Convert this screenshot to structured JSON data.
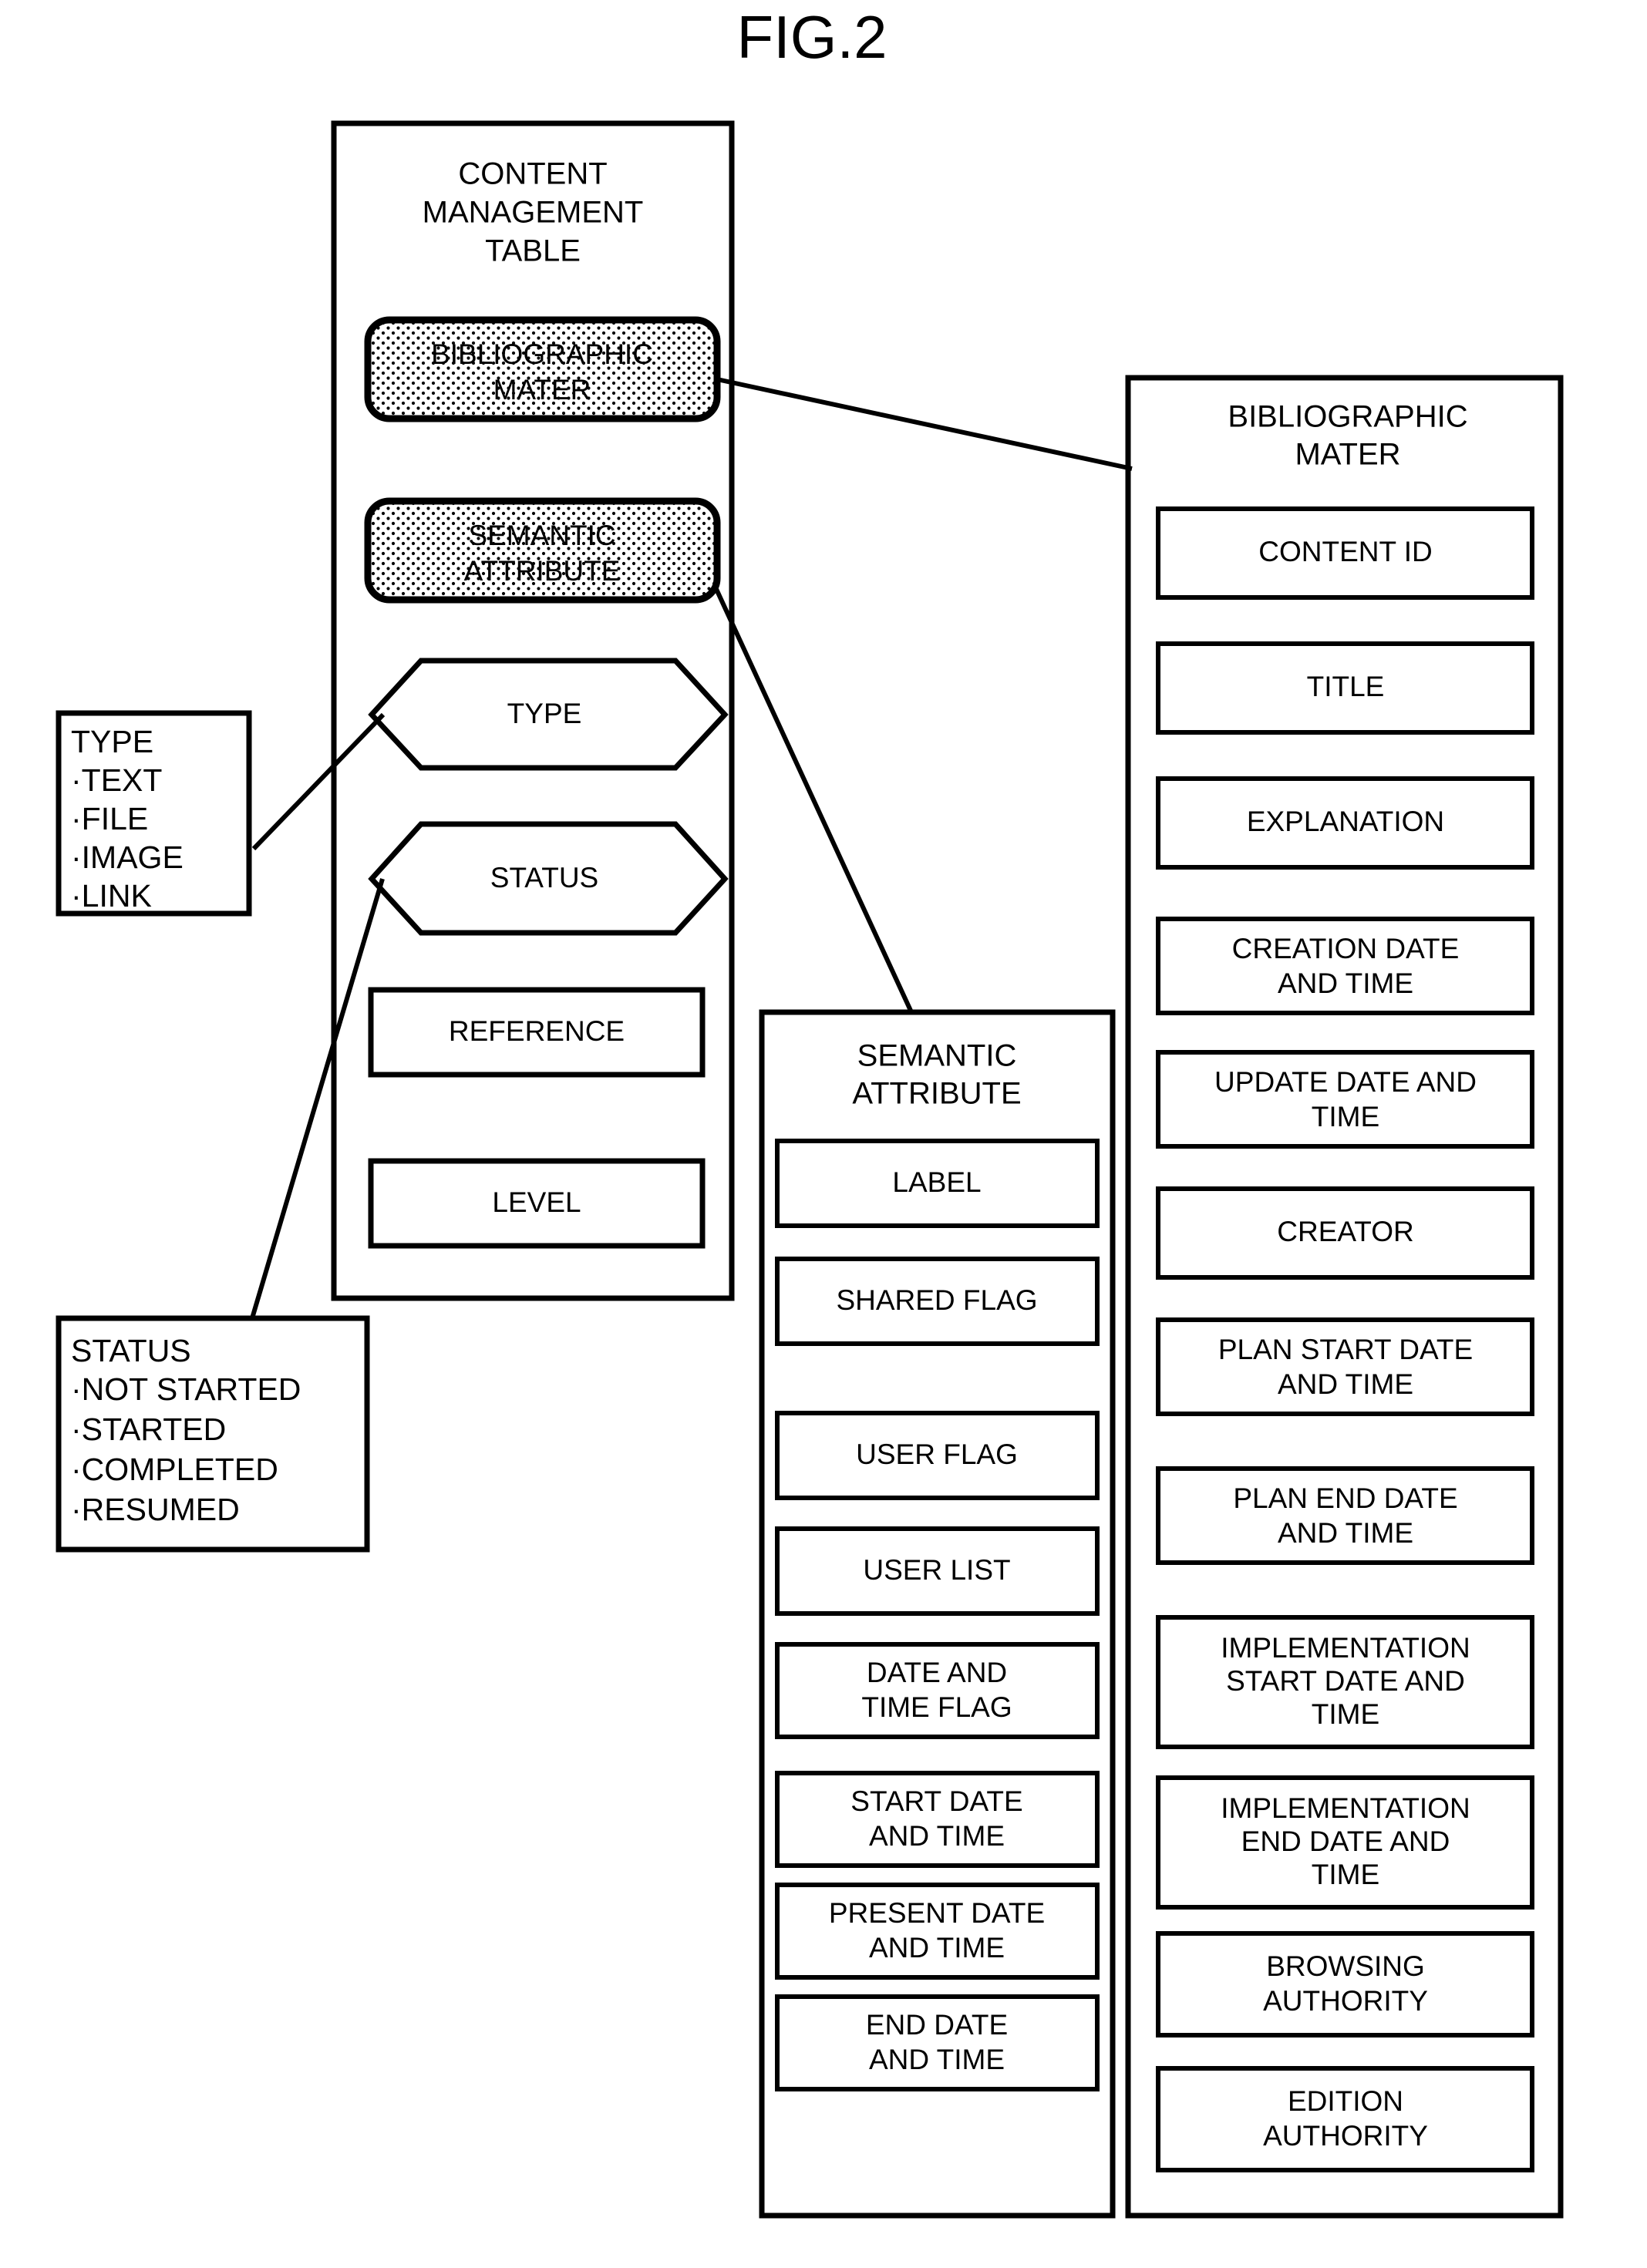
{
  "figure": {
    "title": "FIG.2"
  },
  "content_management_table": {
    "title_lines": [
      "CONTENT",
      "MANAGEMENT",
      "TABLE"
    ],
    "fields": [
      {
        "id": "bibliographic-mater",
        "shape": "rounded-stipple",
        "lines": [
          "BIBLIOGRAPHIC",
          "MATER"
        ]
      },
      {
        "id": "semantic-attribute",
        "shape": "rounded-stipple",
        "lines": [
          "SEMANTIC",
          "ATTRIBUTE"
        ]
      },
      {
        "id": "type",
        "shape": "hexagon",
        "lines": [
          "TYPE"
        ]
      },
      {
        "id": "status",
        "shape": "hexagon",
        "lines": [
          "STATUS"
        ]
      },
      {
        "id": "reference",
        "shape": "rect",
        "lines": [
          "REFERENCE"
        ]
      },
      {
        "id": "level",
        "shape": "rect",
        "lines": [
          "LEVEL"
        ]
      }
    ]
  },
  "type_legend": {
    "title": "TYPE",
    "items": [
      "TEXT",
      "FILE",
      "IMAGE",
      "LINK"
    ],
    "bullet": "·"
  },
  "status_legend": {
    "title": "STATUS",
    "items": [
      "NOT STARTED",
      "STARTED",
      "COMPLETED",
      "RESUMED"
    ],
    "bullet": "·"
  },
  "semantic_attribute_table": {
    "title_lines": [
      "SEMANTIC",
      "ATTRIBUTE"
    ],
    "fields": [
      {
        "id": "label",
        "lines": [
          "LABEL"
        ]
      },
      {
        "id": "shared-flag",
        "lines": [
          "SHARED FLAG"
        ]
      },
      {
        "id": "user-flag",
        "lines": [
          "USER FLAG"
        ]
      },
      {
        "id": "user-list",
        "lines": [
          "USER LIST"
        ]
      },
      {
        "id": "date-and-time-flag",
        "lines": [
          "DATE AND",
          "TIME FLAG"
        ]
      },
      {
        "id": "start-date-and-time",
        "lines": [
          "START DATE",
          "AND TIME"
        ]
      },
      {
        "id": "present-date-and-time",
        "lines": [
          "PRESENT DATE",
          "AND TIME"
        ]
      },
      {
        "id": "end-date-and-time",
        "lines": [
          "END DATE",
          "AND TIME"
        ]
      }
    ]
  },
  "bibliographic_mater_table": {
    "title_lines": [
      "BIBLIOGRAPHIC",
      "MATER"
    ],
    "fields": [
      {
        "id": "content-id",
        "lines": [
          "CONTENT ID"
        ]
      },
      {
        "id": "title",
        "lines": [
          "TITLE"
        ]
      },
      {
        "id": "explanation",
        "lines": [
          "EXPLANATION"
        ]
      },
      {
        "id": "creation-date-and-time",
        "lines": [
          "CREATION DATE",
          "AND TIME"
        ]
      },
      {
        "id": "update-date-and-time",
        "lines": [
          "UPDATE DATE AND",
          "TIME"
        ]
      },
      {
        "id": "creator",
        "lines": [
          "CREATOR"
        ]
      },
      {
        "id": "plan-start-date-and-time",
        "lines": [
          "PLAN START DATE",
          "AND TIME"
        ]
      },
      {
        "id": "plan-end-date-and-time",
        "lines": [
          "PLAN END DATE",
          "AND TIME"
        ]
      },
      {
        "id": "implementation-start-date-and-time",
        "lines": [
          "IMPLEMENTATION",
          "START DATE AND",
          "TIME"
        ]
      },
      {
        "id": "implementation-end-date-and-time",
        "lines": [
          "IMPLEMENTATION",
          "END DATE AND",
          "TIME"
        ]
      },
      {
        "id": "browsing-authority",
        "lines": [
          "BROWSING",
          "AUTHORITY"
        ]
      },
      {
        "id": "edition-authority",
        "lines": [
          "EDITION",
          "AUTHORITY"
        ]
      }
    ]
  },
  "colors": {
    "ink": "#000000",
    "paper": "#ffffff"
  }
}
